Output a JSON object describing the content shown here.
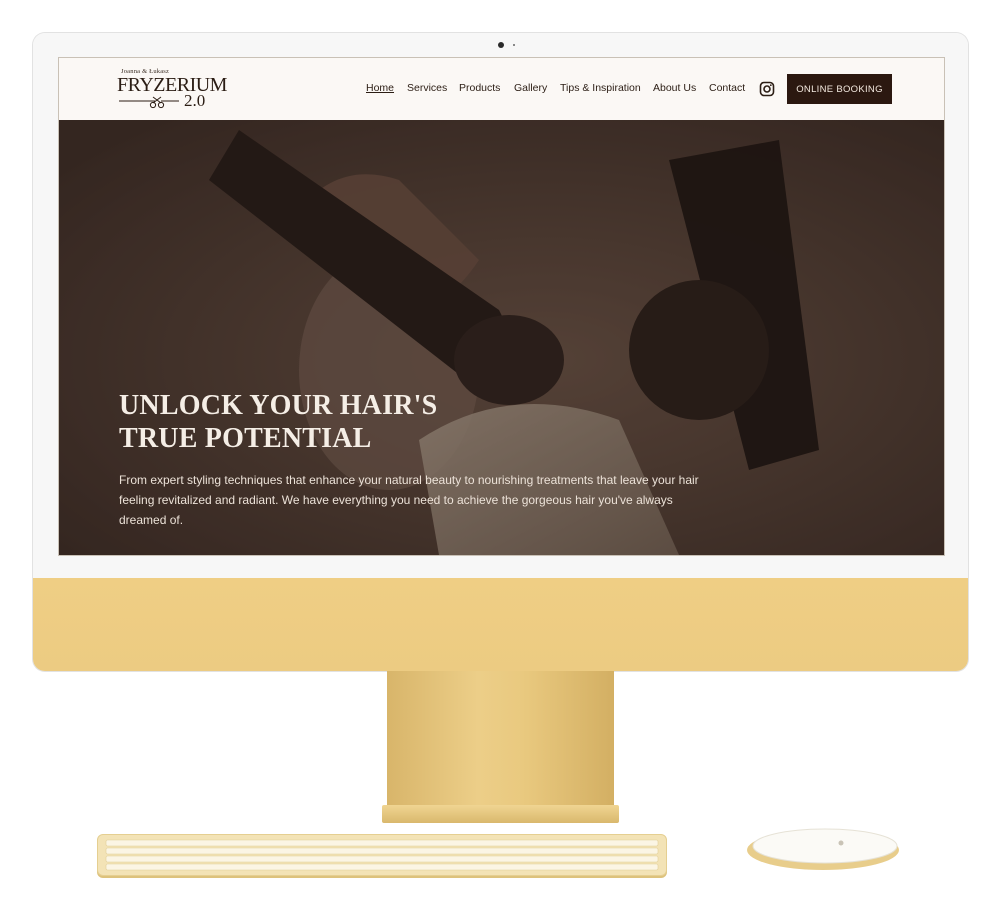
{
  "logo": {
    "owners": "Joanna & Łukasz",
    "name": "FRYZERIUM",
    "version": "2.0"
  },
  "nav": {
    "items": [
      "Home",
      "Services",
      "Products",
      "Gallery",
      "Tips & Inspiration",
      "About Us",
      "Contact"
    ],
    "active": "Home",
    "social_icon": "instagram-icon",
    "booking_label": "ONLINE BOOKING"
  },
  "hero": {
    "title_line1": "UNLOCK YOUR HAIR'S",
    "title_line2": "TRUE POTENTIAL",
    "text": "From expert styling techniques that enhance your natural beauty to nourishing treatments that leave your hair feeling revitalized and radiant. We have everything you need to achieve the gorgeous hair you've always dreamed of."
  },
  "colors": {
    "header_bg": "#fbf8f5",
    "brand_dark": "#2b1810",
    "hero_overlay": "#3b2d27",
    "device_gold": "#eccb82"
  }
}
